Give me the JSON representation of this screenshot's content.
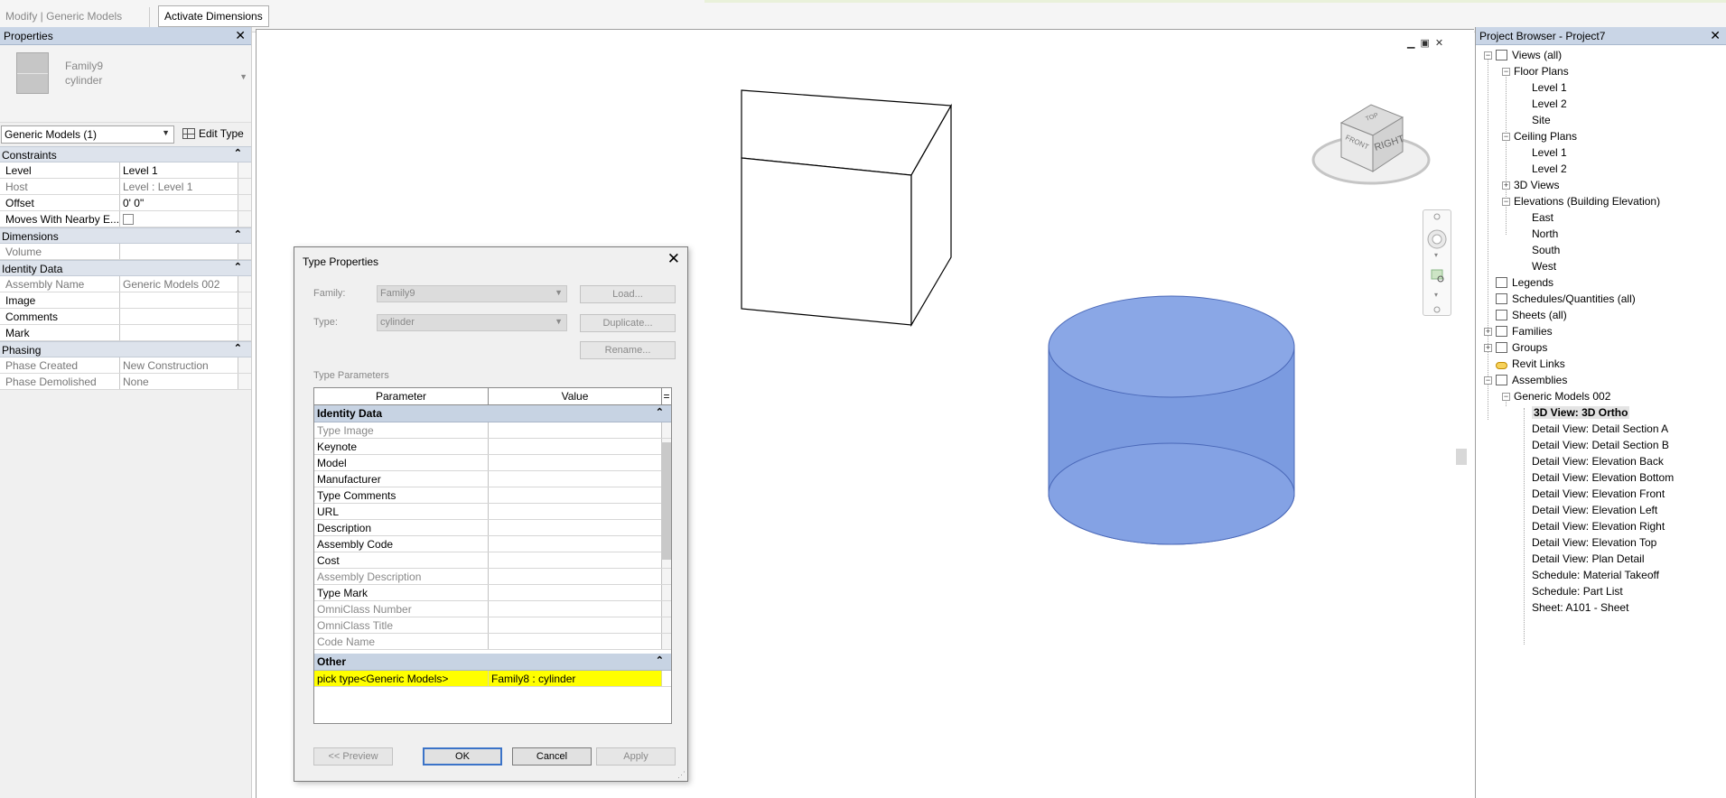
{
  "ribbon": {
    "context_label": "Modify | Generic Models",
    "activate_button": "Activate Dimensions"
  },
  "properties": {
    "title": "Properties",
    "close": "✕",
    "type_family": "Family9",
    "type_name": "cylinder",
    "instance_selector": "Generic Models (1)",
    "edit_type": "Edit Type",
    "groups": [
      {
        "name": "Constraints",
        "rows": [
          {
            "name": "Level",
            "value": "Level 1"
          },
          {
            "name": "Host",
            "value": "Level : Level 1"
          },
          {
            "name": "Offset",
            "value": "0'  0\""
          },
          {
            "name": "Moves With Nearby E...",
            "value": ""
          }
        ]
      },
      {
        "name": "Dimensions",
        "rows": [
          {
            "name": "Volume",
            "value": ""
          }
        ]
      },
      {
        "name": "Identity Data",
        "rows": [
          {
            "name": "Assembly Name",
            "value": "Generic Models 002"
          },
          {
            "name": "Image",
            "value": ""
          },
          {
            "name": "Comments",
            "value": ""
          },
          {
            "name": "Mark",
            "value": ""
          }
        ]
      },
      {
        "name": "Phasing",
        "rows": [
          {
            "name": "Phase Created",
            "value": "New Construction"
          },
          {
            "name": "Phase Demolished",
            "value": "None"
          }
        ]
      }
    ]
  },
  "viewcube": {
    "face_right": "RIGHT",
    "face_front": "FRONT",
    "face_top": "TOP"
  },
  "dialog": {
    "title": "Type Properties",
    "family_label": "Family:",
    "family_value": "Family9",
    "type_label": "Type:",
    "type_value": "cylinder",
    "load_button": "Load...",
    "duplicate_button": "Duplicate...",
    "rename_button": "Rename...",
    "type_params_label": "Type Parameters",
    "col_parameter": "Parameter",
    "col_value": "Value",
    "col_extra": "=",
    "identity_group": "Identity Data",
    "identity_rows": [
      {
        "name": "Type Image",
        "value": ""
      },
      {
        "name": "Keynote",
        "value": ""
      },
      {
        "name": "Model",
        "value": ""
      },
      {
        "name": "Manufacturer",
        "value": ""
      },
      {
        "name": "Type Comments",
        "value": ""
      },
      {
        "name": "URL",
        "value": ""
      },
      {
        "name": "Description",
        "value": ""
      },
      {
        "name": "Assembly Code",
        "value": ""
      },
      {
        "name": "Cost",
        "value": ""
      },
      {
        "name": "Assembly Description",
        "value": ""
      },
      {
        "name": "Type Mark",
        "value": ""
      },
      {
        "name": "OmniClass Number",
        "value": ""
      },
      {
        "name": "OmniClass Title",
        "value": ""
      },
      {
        "name": "Code Name",
        "value": ""
      }
    ],
    "other_group": "Other",
    "other_rows": [
      {
        "name": "pick type<Generic Models>",
        "value": "Family8 : cylinder"
      }
    ],
    "preview_button": "<< Preview",
    "ok_button": "OK",
    "cancel_button": "Cancel",
    "apply_button": "Apply"
  },
  "browser": {
    "title": "Project Browser - Project7",
    "close": "✕",
    "views_all": "Views (all)",
    "floor_plans": "Floor Plans",
    "fp_level1": "Level 1",
    "fp_level2": "Level 2",
    "fp_site": "Site",
    "ceiling_plans": "Ceiling Plans",
    "cp_level1": "Level 1",
    "cp_level2": "Level 2",
    "views_3d": "3D Views",
    "elevations": "Elevations (Building Elevation)",
    "el_east": "East",
    "el_north": "North",
    "el_south": "South",
    "el_west": "West",
    "legends": "Legends",
    "schedules": "Schedules/Quantities (all)",
    "sheets": "Sheets (all)",
    "families": "Families",
    "groups": "Groups",
    "revit_links": "Revit Links",
    "assemblies": "Assemblies",
    "generic_models": "Generic Models 002",
    "assembly_items": [
      "3D View: 3D Ortho",
      "Detail View: Detail Section A",
      "Detail View: Detail Section B",
      "Detail View: Elevation Back",
      "Detail View: Elevation Bottom",
      "Detail View: Elevation Front",
      "Detail View: Elevation Left",
      "Detail View: Elevation Right",
      "Detail View: Elevation Top",
      "Detail View: Plan Detail",
      "Schedule: Material Takeoff",
      "Schedule: Part List",
      "Sheet: A101 - Sheet"
    ]
  },
  "colors": {
    "cylinder_fill": "#7b9be0",
    "highlight": "#ffff00",
    "panel_header": "#c9d5e6"
  }
}
